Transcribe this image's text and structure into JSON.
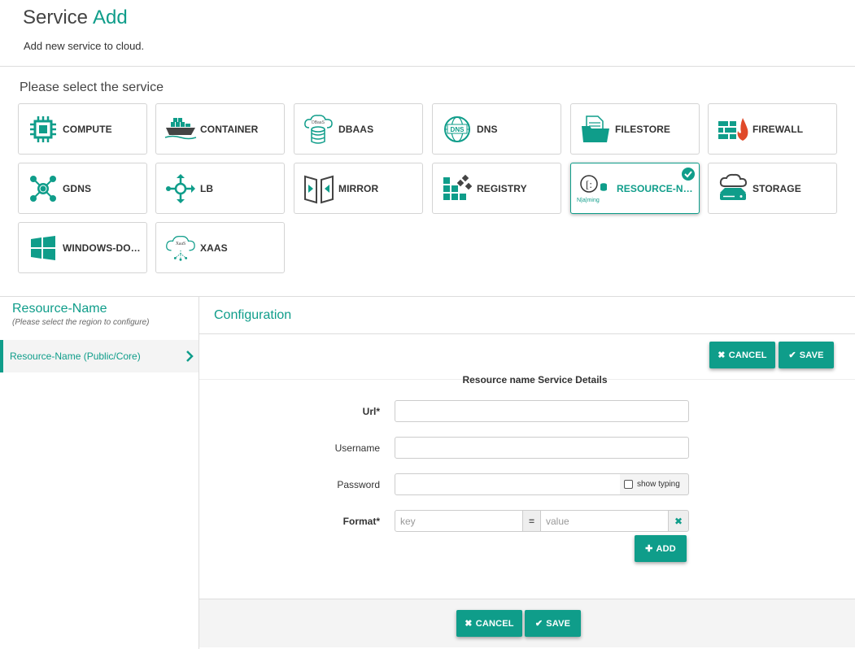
{
  "header": {
    "title": "Service",
    "title_accent": "Add",
    "subtitle": "Add new service to cloud."
  },
  "service_select": {
    "label": "Please select the service",
    "services": [
      {
        "label": "COMPUTE",
        "icon": "cpu-chip-icon"
      },
      {
        "label": "CONTAINER",
        "icon": "container-ship-icon"
      },
      {
        "label": "DBAAS",
        "icon": "cloud-database-icon"
      },
      {
        "label": "DNS",
        "icon": "dns-globe-icon"
      },
      {
        "label": "FILESTORE",
        "icon": "folder-document-icon"
      },
      {
        "label": "FIREWALL",
        "icon": "firewall-icon"
      },
      {
        "label": "GDNS",
        "icon": "network-hub-icon"
      },
      {
        "label": "LB",
        "icon": "load-balancer-icon"
      },
      {
        "label": "MIRROR",
        "icon": "mirror-doors-icon"
      },
      {
        "label": "REGISTRY",
        "icon": "registry-blocks-icon"
      },
      {
        "label": "RESOURCE-NAME",
        "icon": "naming-icon",
        "icon_text": "N|a|ming",
        "selected": true
      },
      {
        "label": "STORAGE",
        "icon": "cloud-storage-icon"
      },
      {
        "label": "WINDOWS-DOM...",
        "icon": "windows-logo-icon"
      },
      {
        "label": "XAAS",
        "icon": "xaas-cloud-icon",
        "icon_text": "XaaS"
      }
    ],
    "dbaas_icon_text": "DBaaS",
    "dns_icon_text": "DNS"
  },
  "left_panel": {
    "title": "Resource-Name",
    "subtitle": "(Please select the region to configure)",
    "regions": [
      {
        "label": "Resource-Name (Public/Core)"
      }
    ]
  },
  "config": {
    "title": "Configuration",
    "cancel_label": "CANCEL",
    "save_label": "SAVE",
    "section_title": "Resource name Service Details",
    "fields": {
      "url_label": "Url*",
      "username_label": "Username",
      "password_label": "Password",
      "show_typing_label": "show typing",
      "format_label": "Format*",
      "key_placeholder": "key",
      "eq_label": "=",
      "value_placeholder": "value",
      "add_label": "ADD"
    }
  },
  "colors": {
    "accent": "#0f9d8a"
  }
}
